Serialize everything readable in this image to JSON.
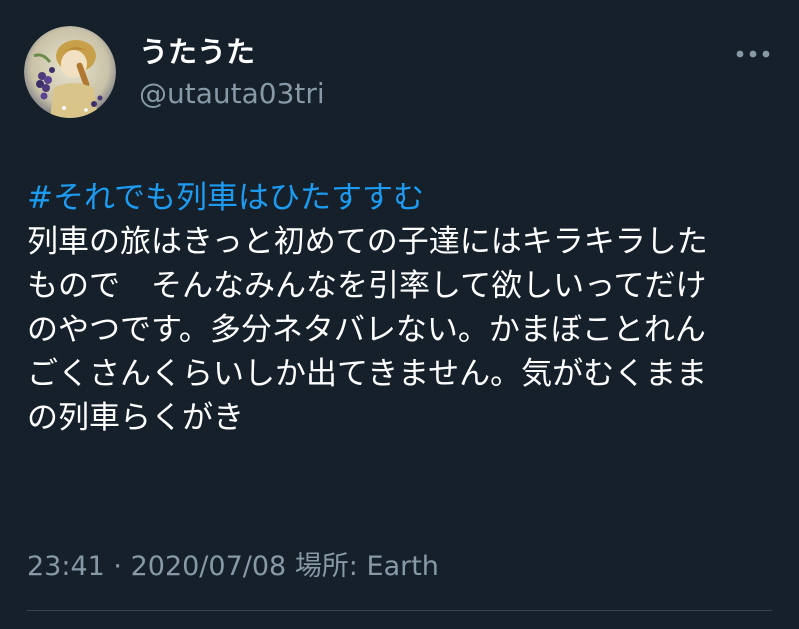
{
  "author": {
    "display_name": "うたうた",
    "handle": "@utauta03tri"
  },
  "more_icon": "ellipsis-horizontal-icon",
  "tweet": {
    "hashtag": "#それでも列車はひたすすむ",
    "lines": [
      "列車の旅はきっと初めての子達にはキラキラした",
      "もので　そんなみんなを引率して欲しいってだけ",
      "のやつです。多分ネタバレない。かまぼことれん",
      "ごくさんくらいしか出てきません。気がむくまま",
      "の列車らくがき"
    ]
  },
  "meta": {
    "time": "23:41",
    "separator": "·",
    "date": "2020/07/08",
    "location_label": "場所:",
    "location": "Earth"
  },
  "colors": {
    "background": "#15202b",
    "hashtag": "#1d9bf0",
    "secondary_text": "#8899a6"
  }
}
